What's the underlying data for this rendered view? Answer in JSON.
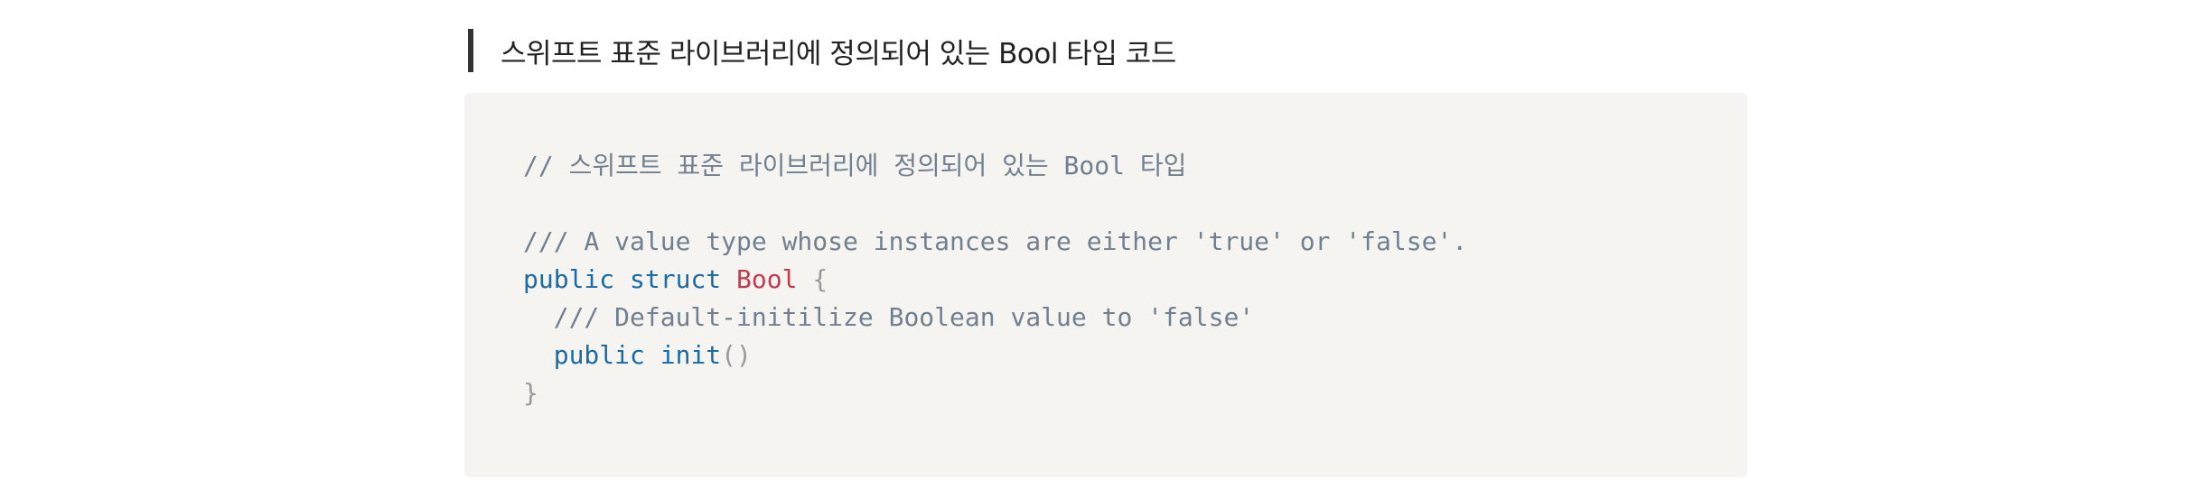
{
  "heading": {
    "title": "스위프트 표준 라이브러리에 정의되어 있는 Bool 타입 코드"
  },
  "code": {
    "comment_line": "// 스위프트 표준 라이브러리에 정의되어 있는 Bool 타입",
    "doc_comment_1": "/// A value type whose instances are either 'true' or 'false'.",
    "kw_public_1": "public",
    "kw_struct": "struct",
    "type_name": "Bool",
    "open_brace": "{",
    "doc_comment_2": "/// Default-initilize Boolean value to 'false'",
    "kw_public_2": "public",
    "kw_init": "init",
    "parens": "()",
    "close_brace": "}"
  },
  "colors": {
    "code_background": "#f5f4f0",
    "keyword": "#1a6aa6",
    "type": "#c7384f",
    "comment": "#708090",
    "punctuation": "#999999",
    "heading_bar": "#333333"
  }
}
